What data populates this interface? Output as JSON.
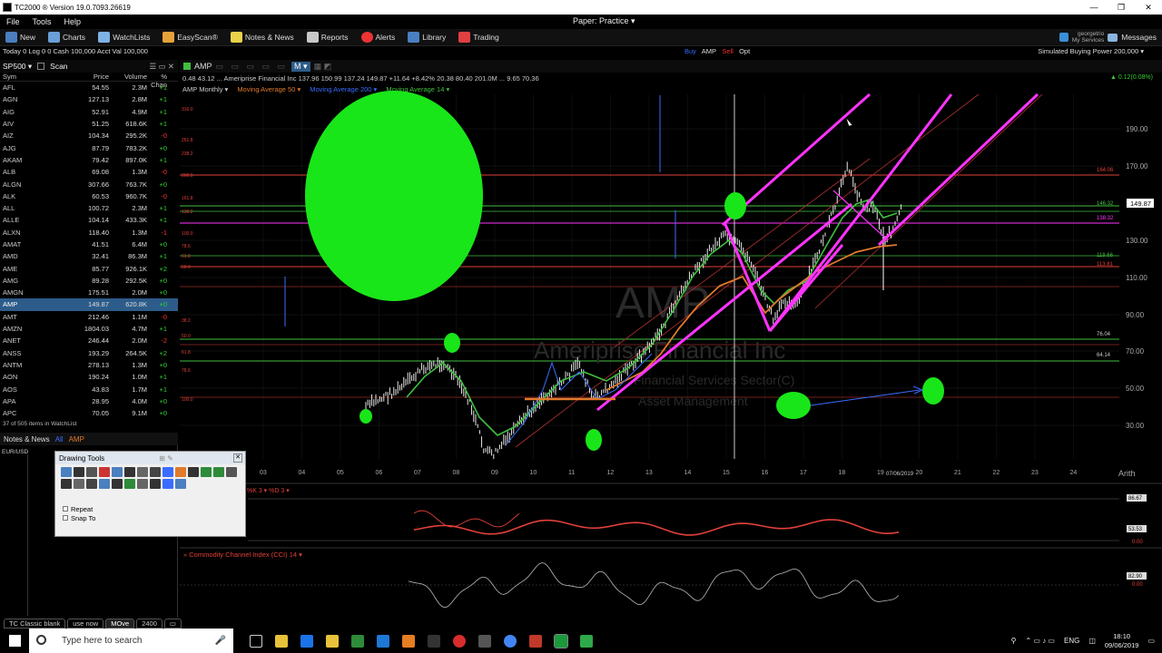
{
  "window": {
    "title": "TC2000 ® Version 19.0.7093.26619",
    "controls": [
      "—",
      "❒",
      "✕"
    ]
  },
  "menu": {
    "items": [
      "File",
      "Tools",
      "Help"
    ],
    "account_mode": "Paper: Practice ▾"
  },
  "toolbar": {
    "buttons": [
      "New",
      "Charts",
      "WatchLists",
      "EasyScan®",
      "Notes & News",
      "Reports",
      "Alerts",
      "Library",
      "Trading"
    ],
    "user_top": "georgetrio",
    "user_bottom": "My Services",
    "messages": "Messages"
  },
  "status": {
    "left": "Today 0  Log 0 0  Cash 100,000  Acct Val 100,000",
    "center_buy": "Buy",
    "center_sym": "AMP",
    "center_sell": "Sell",
    "center_opt": "Opt",
    "right": "Simulated Buying Power 200,000 ▾"
  },
  "watchlist": {
    "list_name": "SP500 ▾",
    "scan_label": "Scan",
    "columns": [
      "Sym",
      "Price",
      "Volume",
      "% Chan"
    ],
    "rows": [
      [
        "AFL",
        "54.55",
        "2.3M",
        "+1"
      ],
      [
        "AGN",
        "127.13",
        "2.8M",
        "+1"
      ],
      [
        "AIG",
        "52.91",
        "4.9M",
        "+1"
      ],
      [
        "AIV",
        "51.25",
        "618.6K",
        "+1"
      ],
      [
        "AIZ",
        "104.34",
        "295.2K",
        "-0"
      ],
      [
        "AJG",
        "87.79",
        "783.2K",
        "+0"
      ],
      [
        "AKAM",
        "79.42",
        "897.0K",
        "+1"
      ],
      [
        "ALB",
        "69.08",
        "1.3M",
        "-0"
      ],
      [
        "ALGN",
        "307.66",
        "763.7K",
        "+0"
      ],
      [
        "ALK",
        "60.53",
        "960.7K",
        "-0"
      ],
      [
        "ALL",
        "100.72",
        "2.3M",
        "+1"
      ],
      [
        "ALLE",
        "104.14",
        "433.3K",
        "+1"
      ],
      [
        "ALXN",
        "118.40",
        "1.3M",
        "-1"
      ],
      [
        "AMAT",
        "41.51",
        "6.4M",
        "+0"
      ],
      [
        "AMD",
        "32.41",
        "86.3M",
        "+1"
      ],
      [
        "AME",
        "85.77",
        "926.1K",
        "+2"
      ],
      [
        "AMG",
        "89.28",
        "292.5K",
        "+0"
      ],
      [
        "AMGN",
        "175.51",
        "2.0M",
        "+0"
      ],
      [
        "AMP",
        "149.87",
        "620.8K",
        "+0"
      ],
      [
        "AMT",
        "212.46",
        "1.1M",
        "-0"
      ],
      [
        "AMZN",
        "1804.03",
        "4.7M",
        "+1"
      ],
      [
        "ANET",
        "246.44",
        "2.0M",
        "-2"
      ],
      [
        "ANSS",
        "193.29",
        "264.5K",
        "+2"
      ],
      [
        "ANTM",
        "278.13",
        "1.3M",
        "+0"
      ],
      [
        "AON",
        "190.24",
        "1.0M",
        "+1"
      ],
      [
        "AOS",
        "43.83",
        "1.7M",
        "+1"
      ],
      [
        "APA",
        "28.95",
        "4.0M",
        "+0"
      ],
      [
        "APC",
        "70.05",
        "9.1M",
        "+0"
      ]
    ],
    "selected": "AMP",
    "footer": "37 of 505 items in WatchList"
  },
  "notes": {
    "label": "Notes & News",
    "all": "All",
    "sym": "AMP",
    "eur": "EUR/USD"
  },
  "chart": {
    "symbol": "AMP",
    "quote": "0.48  43.12  ...  Ameriprise Financial Inc   137.96  150.99  137.24  149.87  +11.64  +8.42%  20.38  80.40  201.0M  ...  9.65  70.36",
    "quote_right": "▲ 0.12(0.08%)",
    "legend": [
      {
        "label": "AMP Monthly ▾",
        "color": "#cccccc"
      },
      {
        "label": "Moving Average 50 ▾",
        "color": "#e07a2c"
      },
      {
        "label": "Moving Average 200 ▾",
        "color": "#3a6cff"
      },
      {
        "label": "Moving Average 14 ▾",
        "color": "#3fbf3f"
      }
    ],
    "watermark": {
      "sym": "AMP",
      "name": "Ameriprise Financial Inc",
      "sector": "Financial Services Sector(C)",
      "industry": "Asset Management"
    },
    "y_ticks": [
      "190.00",
      "170.00",
      "150.00",
      "130.00",
      "110.00",
      "90.00",
      "70.00",
      "50.00",
      "30.00"
    ],
    "x_ticks": [
      "03",
      "04",
      "05",
      "06",
      "07",
      "08",
      "09",
      "10",
      "11",
      "12",
      "13",
      "14",
      "15",
      "16",
      "17",
      "18",
      "19",
      "20",
      "21",
      "22",
      "23",
      "24"
    ],
    "date_label": "07/06/2019",
    "last_price": "149.87",
    "price_labels": [
      "164.06",
      "146.32",
      "138.32",
      "118.66",
      "113.81",
      "76.04",
      "64.14"
    ],
    "scale": "Arith",
    "sub1_label": "%K 3 ▾  %D 3 ▾",
    "sub1_vals": [
      "86.67",
      "53.53",
      "0.00"
    ],
    "sub2_label": "»  Commodity Channel Index (CCI) 14 ▾",
    "sub2_vals": [
      "82.90",
      "0.00"
    ],
    "colors": {
      "candle": "#ffffff",
      "ma14": "#3fbf3f",
      "ma50": "#e07a2c",
      "ma200": "#3a6cff",
      "channel": "#ff33ff",
      "blob": "#19e619",
      "hline_red": "#e0403a",
      "hline_green": "#3fbf3f"
    }
  },
  "drawing_tools": {
    "title": "Drawing Tools",
    "repeat": "Repeat",
    "snap": "Snap To"
  },
  "layout_tabs": [
    "TC Classic blank",
    "use now",
    "MOve",
    "2400"
  ],
  "layout_active": "MOve",
  "taskbar": {
    "search_placeholder": "Type here to search",
    "lang": "ENG",
    "time": "18:10",
    "date": "09/06/2019"
  }
}
